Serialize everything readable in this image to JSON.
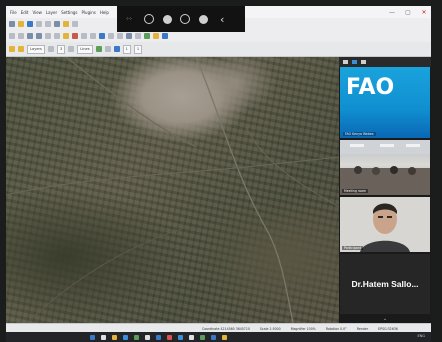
{
  "window": {
    "menu": [
      "File",
      "Edit",
      "View",
      "Layer",
      "Settings",
      "Plugins",
      "Help"
    ],
    "controls": {
      "minimize": "—",
      "maximize": "▢",
      "close": "✕"
    }
  },
  "toolbar": {
    "field_1": "Layers",
    "field_2": "3",
    "field_3": "Lines",
    "field_4": "1",
    "field_5": "1"
  },
  "overlay": {
    "icons": [
      "grid-icon",
      "dot-icon",
      "bulb-icon",
      "ring-icon",
      "lamp-icon",
      "chevron-left-icon"
    ],
    "grid_glyph": "⁘⁘",
    "chevron_glyph": "‹"
  },
  "panel": {
    "fao_logo": "FAO",
    "fao_caption": "FAO Kenya Webex",
    "room_caption": "Meeting room",
    "person_caption": "Participant",
    "featured_name": "Dr.Hatem Sallo...",
    "expand_glyph": "⌄"
  },
  "statusbar": {
    "coordinate": "Coordinate  4214560  3645710",
    "scale": "Scale  1:5000",
    "magnifier": "Magnifier  100%",
    "rotation": "Rotation  0.0°",
    "render": "Render",
    "crs": "EPSG:32636"
  },
  "taskbar": {
    "icon_colors": [
      "#3a78c8",
      "#e0e0e0",
      "#e2b43a",
      "#3a8fd8",
      "#5a9e5a",
      "#e0e0e0",
      "#3a78c8",
      "#d9534f",
      "#3a8fd8",
      "#e0e0e0",
      "#5a9e5a",
      "#3a78c8",
      "#e2b43a"
    ],
    "tray_text": "ENG"
  },
  "colors": {
    "fao_blue": "#1aa3dd",
    "panel_bg": "#1a1a1a",
    "close_red": "#c62828"
  }
}
